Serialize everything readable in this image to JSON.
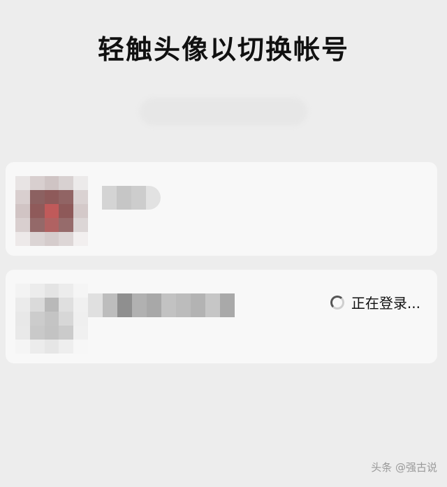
{
  "header": {
    "title": "轻触头像以切换帐号"
  },
  "accounts": [
    {
      "avatar": "blurred-avatar",
      "name": ""
    },
    {
      "avatar": "blurred-avatar",
      "name": "",
      "status_text": "正在登录..."
    }
  ],
  "watermark": "头条 @强古说",
  "colors": {
    "background": "#ededed",
    "card": "#f8f8f8",
    "title": "#111111",
    "avatar_accent": "#c05a5a",
    "watermark": "#999999"
  }
}
